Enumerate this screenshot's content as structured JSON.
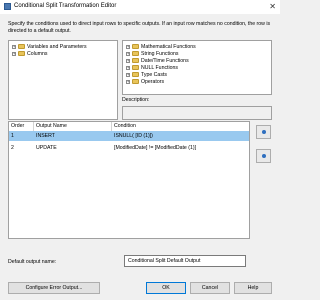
{
  "window": {
    "title": "Conditional Split Transformation Editor"
  },
  "description": "Specify the conditions used to direct input rows to specific outputs. If an input row matches no condition, the row is directed to a default output.",
  "left_tree": [
    {
      "label": "Variables and Parameters"
    },
    {
      "label": "Columns"
    }
  ],
  "right_tree": [
    {
      "label": "Mathematical Functions"
    },
    {
      "label": "String Functions"
    },
    {
      "label": "Date/Time Functions"
    },
    {
      "label": "NULL Functions"
    },
    {
      "label": "Type Casts"
    },
    {
      "label": "Operators"
    }
  ],
  "description_panel": {
    "label": "Description:"
  },
  "grid": {
    "headers": [
      "Order",
      "Output Name",
      "Condition"
    ],
    "rows": [
      {
        "order": "1",
        "output_name": "INSERT",
        "condition": "ISNULL( [ID (1)])",
        "selected": true
      },
      {
        "order": "2",
        "output_name": "UPDATE",
        "condition": "[ModifiedDate] != [ModifiedDate (1)]",
        "selected": false
      }
    ]
  },
  "default_output": {
    "label": "Default output name:",
    "value": "Conditional Split Default Output"
  },
  "buttons": {
    "configure": "Configure Error Output...",
    "ok": "OK",
    "cancel": "Cancel",
    "help": "Help"
  },
  "icons": {
    "close": "close-icon",
    "folder": "folder-icon",
    "expand": "expand-icon",
    "move_up": "move-up-icon",
    "move_down": "move-down-icon"
  },
  "colors": {
    "selection": "#99c9ef",
    "accent": "#0078d7",
    "folder": "#e8c45a"
  }
}
